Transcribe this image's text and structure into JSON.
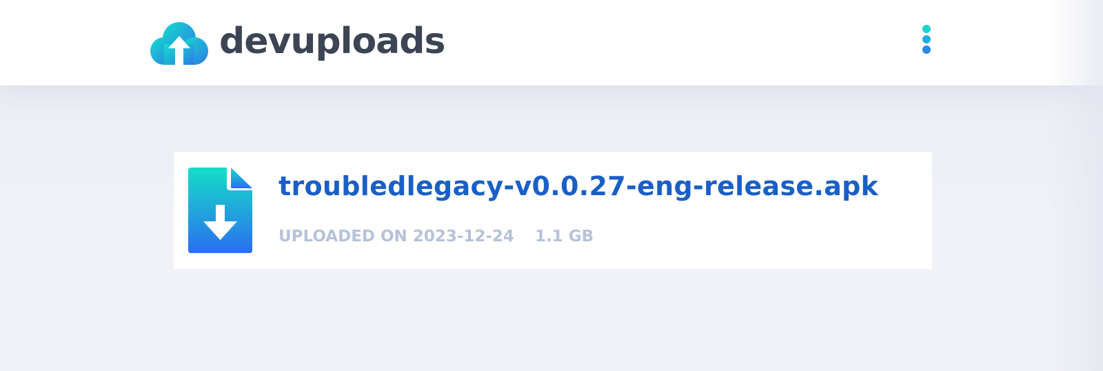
{
  "header": {
    "brand_name": "devuploads",
    "logo_icon": "cloud-upload-icon",
    "menu_icon": "kebab-menu-icon",
    "colors": {
      "brand_text": "#3d4554",
      "gradient_start": "#16dccb",
      "gradient_end": "#2c7be8"
    }
  },
  "file": {
    "icon": "file-download-icon",
    "name": "troubledlegacy-v0.0.27-eng-release.apk",
    "uploaded_label": "UPLOADED ON 2023-12-24",
    "size": "1.1 GB",
    "colors": {
      "name": "#1a5fc6",
      "meta": "#b6c2d8"
    }
  }
}
